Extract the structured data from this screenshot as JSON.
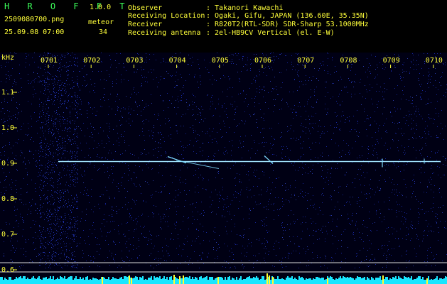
{
  "app": {
    "logo": "H R O F F T",
    "version": "1.0.0"
  },
  "file": {
    "name": "2509080700.png",
    "datetime": "25.09.08 07:00",
    "meteor_label": "meteor",
    "meteor_count": "34"
  },
  "info": [
    {
      "label": "Observer",
      "value": ": Takanori Kawachi"
    },
    {
      "label": "Receiving Location",
      "value": ": Ogaki, Gifu, JAPAN (136.60E, 35.35N)"
    },
    {
      "label": "Receiver",
      "value": ": R820T2(RTL-SDR) SDR-Sharp 53.1000MHz"
    },
    {
      "label": "Receiving antenna",
      "value": ": 2el-HB9CV Vertical (el. E-W)"
    }
  ],
  "chart_data": {
    "type": "heatmap",
    "ylabel": "kHz",
    "x_ticks": [
      "0701",
      "0702",
      "0703",
      "0704",
      "0705",
      "0706",
      "0707",
      "0708",
      "0709",
      "0710"
    ],
    "y_ticks": [
      "1.1",
      "1.0",
      "0.9",
      "0.8",
      "0.7",
      "0.6"
    ],
    "ylim": [
      0.585,
      1.175
    ],
    "carrier_khz": 0.905,
    "colors": {
      "background": "#000014",
      "noise": "#1a2aa8",
      "signal": "#7fdcff",
      "bottom_band": "#19e6ff",
      "meteor_bars": "#ffff30",
      "ticks": "#ffff3a"
    }
  }
}
